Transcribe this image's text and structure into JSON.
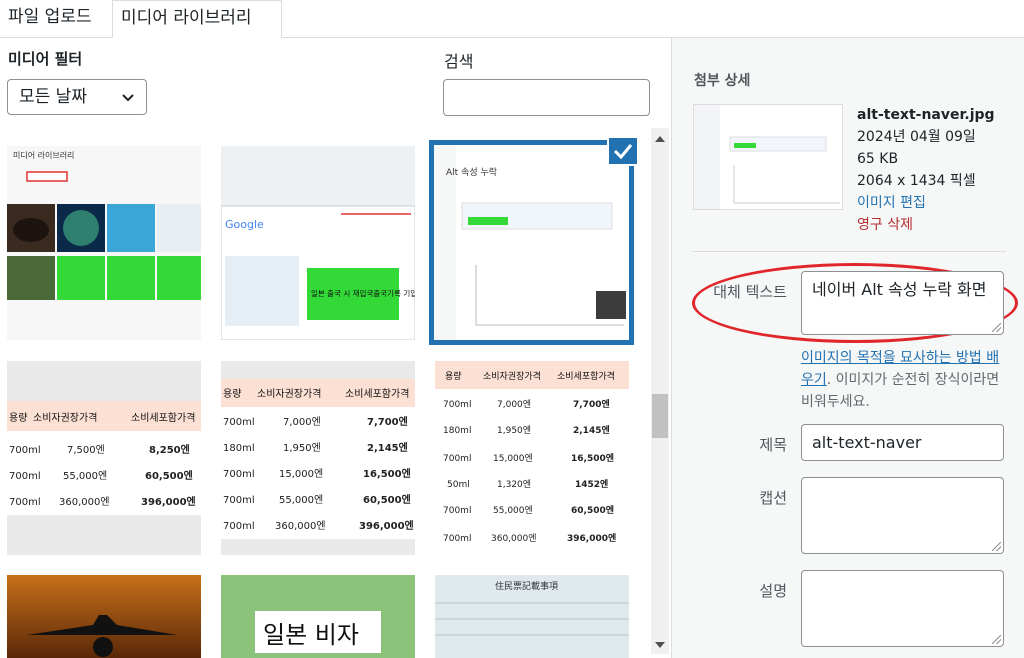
{
  "tabs": [
    {
      "label": "파일 업로드"
    },
    {
      "label": "미디어 라이브러리"
    }
  ],
  "filter": {
    "label": "미디어 필터",
    "date_value": "모든 날짜",
    "search_label": "검색",
    "search_value": ""
  },
  "thumbnails": [
    {
      "name": "미디어 라이브러리 screenshot",
      "text": "미디어 라이브러리"
    },
    {
      "name": "google search screenshot",
      "text": "일본 출국 시 재입국출국기록 기입방법"
    },
    {
      "name": "alt-text-naver screenshot",
      "text": "Alt 속성 누락",
      "selected": true
    },
    {
      "name": "price table 1",
      "header": [
        "용량",
        "소비자권장가격",
        "소비세포함가격"
      ],
      "rows": [
        [
          "700ml",
          "7,500엔",
          "8,250엔"
        ],
        [
          "700ml",
          "55,000엔",
          "60,500엔"
        ],
        [
          "700ml",
          "360,000엔",
          "396,000엔"
        ]
      ]
    },
    {
      "name": "price table 2",
      "header": [
        "용량",
        "소비자권장가격",
        "소비세포함가격"
      ],
      "rows": [
        [
          "700ml",
          "7,000엔",
          "7,700엔"
        ],
        [
          "180ml",
          "1,950엔",
          "2,145엔"
        ],
        [
          "700ml",
          "15,000엔",
          "16,500엔"
        ],
        [
          "700ml",
          "55,000엔",
          "60,500엔"
        ],
        [
          "700ml",
          "360,000엔",
          "396,000엔"
        ]
      ]
    },
    {
      "name": "price table 3",
      "header": [
        "용량",
        "소비자권장가격",
        "소비세포함가격"
      ],
      "rows": [
        [
          "700ml",
          "7,000엔",
          "7,700엔"
        ],
        [
          "180ml",
          "1,950엔",
          "2,145엔"
        ],
        [
          "700ml",
          "15,000엔",
          "16,500엔"
        ],
        [
          "50ml",
          "1,320엔",
          "1452엔"
        ],
        [
          "700ml",
          "55,000엔",
          "60,500엔"
        ],
        [
          "700ml",
          "360,000엔",
          "396,000엔"
        ]
      ]
    },
    {
      "name": "airplane sunset"
    },
    {
      "name": "japan visa",
      "text": "일본 비자"
    },
    {
      "name": "japanese document",
      "text": "住民票記載事項"
    }
  ],
  "details": {
    "title": "첨부 상세",
    "filename": "alt-text-naver.jpg",
    "date": "2024년 04월 09일",
    "size": "65 KB",
    "dimensions": "2064 x 1434 픽셀",
    "edit_label": "이미지 편집",
    "delete_label": "영구 삭제",
    "alt_label": "대체 텍스트",
    "alt_value": "네이버 Alt 속성 누락 화면",
    "help_link": "이미지의 목적을 묘사하는 방법 배우기",
    "help_text": ". 이미지가 순전히 장식이라면 비워두세요.",
    "title_label": "제목",
    "title_value": "alt-text-naver",
    "caption_label": "캡션",
    "caption_value": "",
    "desc_label": "설명",
    "desc_value": ""
  },
  "colors": {
    "accent": "#2271b1",
    "danger": "#b32d2e",
    "highlight": "#e0262b"
  }
}
